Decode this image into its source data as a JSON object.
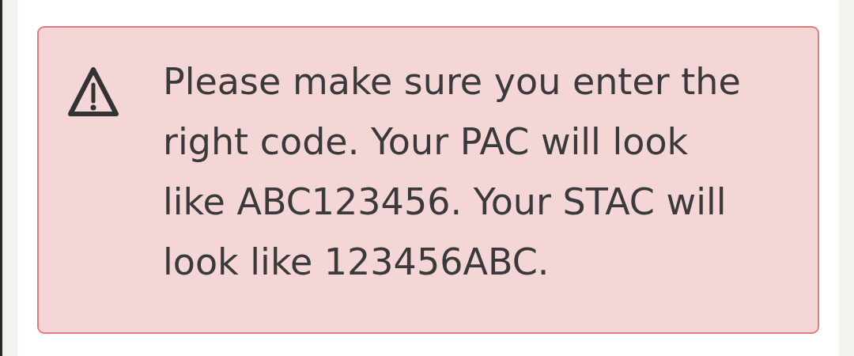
{
  "alert": {
    "kind": "warning",
    "message": "Please make sure you enter the right code. Your PAC will look like ABC123456. Your STAC will look like 123456ABC."
  }
}
